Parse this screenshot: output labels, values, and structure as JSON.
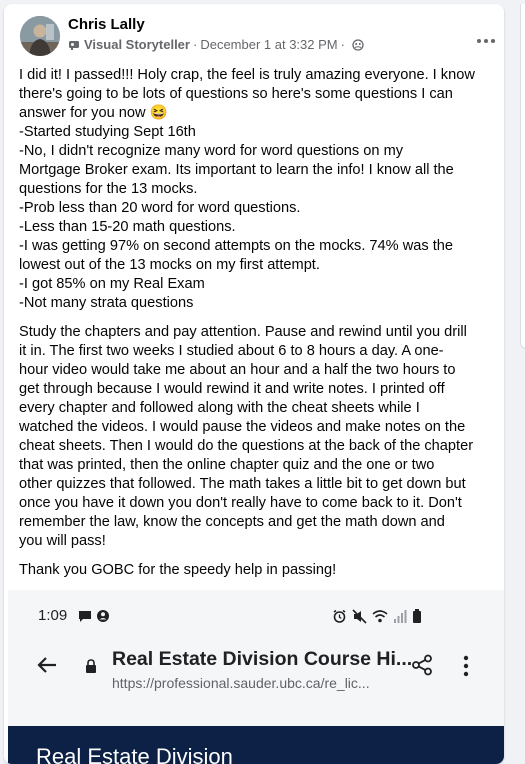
{
  "post": {
    "author": "Chris Lally",
    "author_badge": "Visual Storyteller",
    "separator": "·",
    "timestamp": "December 1 at 3:32 PM",
    "privacy_separator": "·",
    "more_icon": "horizontal-ellipsis-icon",
    "paragraph1": [
      "I did it! I passed!!! Holy crap, the feel is truly amazing everyone. I know",
      "there's going to be lots of questions so here's some questions I can",
      "answer for you now 😆",
      "-Started studying Sept 16th",
      "-No, I didn't recognize many word for word questions on my",
      "Mortgage Broker exam. Its important to learn the info! I know all the",
      "questions for the 13 mocks.",
      "-Prob less than 20 word for word questions.",
      "-Less than 15-20 math questions.",
      "-I was getting 97% on second attempts on the mocks. 74% was the",
      "lowest out of the 13 mocks on my first attempt.",
      "-I got 85% on my Real Exam",
      "-Not many strata questions"
    ],
    "paragraph2": [
      "Study the chapters and pay attention. Pause and rewind until you drill",
      "it in. The first two weeks I studied about 6 to 8 hours a day. A one-",
      "hour video would take me about an hour and a half the two hours to",
      "get through because I would rewind it and write notes. I printed off",
      "every chapter and followed along with the cheat sheets while I",
      "watched the videos. I would pause the videos and make notes on the",
      "cheat sheets. Then I would do the questions at the back of the chapter",
      "that was printed, then the online chapter quiz and the one or two",
      "other quizzes that followed. The math takes a little bit to get down but",
      "once you have it down you don't really have to come back to it. Don't",
      "remember the law, know the concepts and get the math down and",
      "you will pass!"
    ],
    "paragraph3": [
      "Thank you GOBC for the speedy help in passing!"
    ]
  },
  "attached_screenshot": {
    "status_time": "1:09",
    "page_title": "Real Estate Division Course Hi...",
    "page_url": "https://professional.sauder.ubc.ca/re_lic...",
    "banner_text": "Real Estate Division"
  },
  "colors": {
    "background": "#f0f2f5",
    "card": "#ffffff",
    "secondary_text": "#65676b",
    "banner": "#0c2145"
  }
}
